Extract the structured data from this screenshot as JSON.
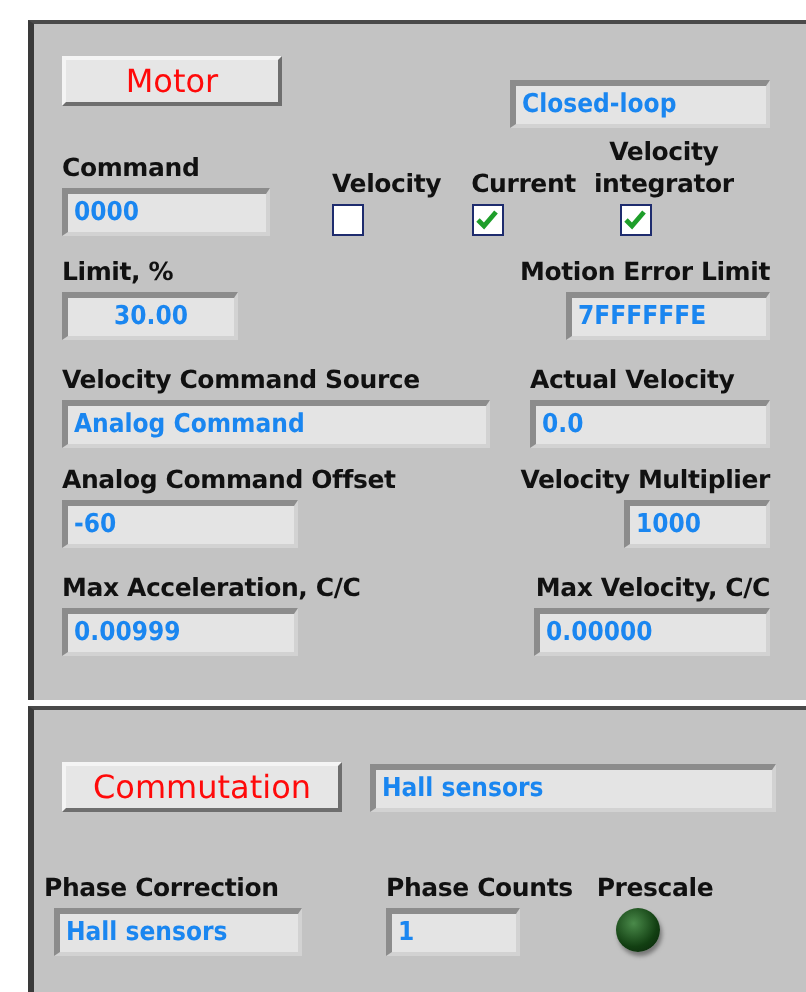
{
  "motor": {
    "button": "Motor",
    "mode": "Closed-loop",
    "command": {
      "label": "Command",
      "value": "0000"
    },
    "checkboxes": [
      {
        "label": "Velocity",
        "checked": false
      },
      {
        "label": "Current",
        "checked": true
      },
      {
        "label": "Velocity integrator",
        "checked": true
      }
    ],
    "limit": {
      "label": "Limit, %",
      "value": "30.00"
    },
    "motion_error_limit": {
      "label": "Motion Error Limit",
      "value": "7FFFFFFE"
    },
    "velocity_command_source": {
      "label": "Velocity Command Source",
      "value": "Analog Command"
    },
    "actual_velocity": {
      "label": "Actual Velocity",
      "value": "0.0"
    },
    "analog_command_offset": {
      "label": "Analog Command Offset",
      "value": "-60"
    },
    "velocity_multiplier": {
      "label": "Velocity Multiplier",
      "value": "1000"
    },
    "max_acceleration": {
      "label": "Max Acceleration, C/C",
      "value": "0.00999"
    },
    "max_velocity": {
      "label": "Max Velocity, C/C",
      "value": "0.00000"
    }
  },
  "commutation": {
    "button": "Commutation",
    "mode": "Hall sensors",
    "phase_correction": {
      "label": "Phase Correction",
      "value": "Hall sensors"
    },
    "phase_counts": {
      "label": "Phase Counts",
      "value": "1"
    },
    "prescale": {
      "label": "Prescale",
      "on": false
    }
  }
}
